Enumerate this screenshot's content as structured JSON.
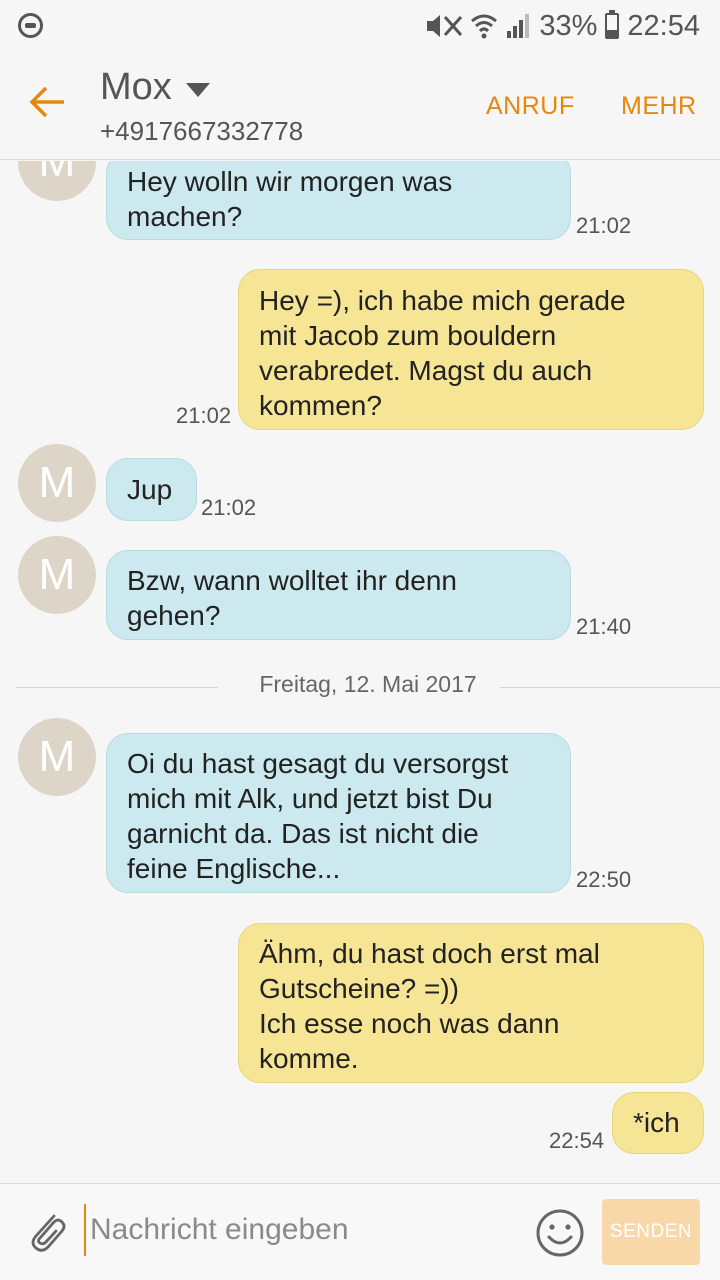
{
  "status_bar": {
    "battery": "33%",
    "battery_level": 0.33,
    "time": "22:54"
  },
  "header": {
    "contact_name": "Mox",
    "contact_number": "+4917667332778",
    "call_label": "ANRUF",
    "more_label": "MEHR"
  },
  "colors": {
    "accent": "#e8870e",
    "incoming_bubble": "#cbe9ee",
    "outgoing_bubble": "#f7e596",
    "avatar": "#ddd6c8"
  },
  "avatar_initial": "M",
  "messages": [
    {
      "direction": "in",
      "lines": [
        "Hey wolln wir morgen was",
        "machen?"
      ],
      "time": "21:02"
    },
    {
      "direction": "out",
      "lines": [
        "Hey =), ich habe mich gerade",
        "mit Jacob zum bouldern",
        "verabredet. Magst du auch",
        "kommen?"
      ],
      "time": "21:02"
    },
    {
      "direction": "in",
      "lines": [
        "Jup"
      ],
      "time": "21:02"
    },
    {
      "direction": "in",
      "lines": [
        "Bzw, wann wolltet ihr denn",
        "gehen?"
      ],
      "time": "21:40"
    },
    {
      "direction": "in",
      "lines": [
        "Oi du hast gesagt du versorgst",
        "mich mit Alk, und jetzt bist Du",
        "garnicht da. Das ist nicht die",
        "feine Englische..."
      ],
      "time": "22:50"
    },
    {
      "direction": "out",
      "lines": [
        "Ähm, du hast doch erst mal",
        "Gutscheine? =))",
        "Ich esse noch was dann",
        "komme."
      ],
      "time": ""
    },
    {
      "direction": "out",
      "lines": [
        "*ich"
      ],
      "time": "22:54"
    }
  ],
  "date_separator": "Freitag, 12. Mai 2017",
  "composer": {
    "placeholder": "Nachricht eingeben",
    "send_label": "SENDEN"
  }
}
